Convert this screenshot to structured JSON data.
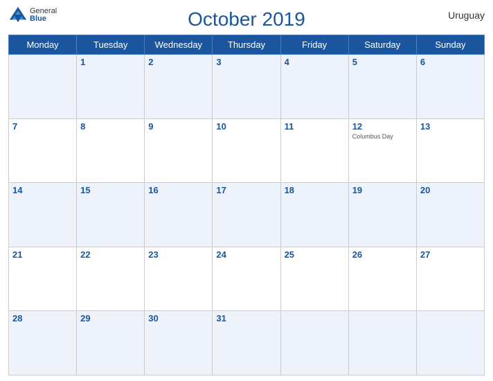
{
  "header": {
    "title": "October 2019",
    "country": "Uruguay",
    "logo": {
      "line1": "General",
      "line2": "Blue"
    }
  },
  "weekdays": [
    "Monday",
    "Tuesday",
    "Wednesday",
    "Thursday",
    "Friday",
    "Saturday",
    "Sunday"
  ],
  "weeks": [
    [
      {
        "day": "",
        "holiday": ""
      },
      {
        "day": "1",
        "holiday": ""
      },
      {
        "day": "2",
        "holiday": ""
      },
      {
        "day": "3",
        "holiday": ""
      },
      {
        "day": "4",
        "holiday": ""
      },
      {
        "day": "5",
        "holiday": ""
      },
      {
        "day": "6",
        "holiday": ""
      }
    ],
    [
      {
        "day": "7",
        "holiday": ""
      },
      {
        "day": "8",
        "holiday": ""
      },
      {
        "day": "9",
        "holiday": ""
      },
      {
        "day": "10",
        "holiday": ""
      },
      {
        "day": "11",
        "holiday": ""
      },
      {
        "day": "12",
        "holiday": "Columbus Day"
      },
      {
        "day": "13",
        "holiday": ""
      }
    ],
    [
      {
        "day": "14",
        "holiday": ""
      },
      {
        "day": "15",
        "holiday": ""
      },
      {
        "day": "16",
        "holiday": ""
      },
      {
        "day": "17",
        "holiday": ""
      },
      {
        "day": "18",
        "holiday": ""
      },
      {
        "day": "19",
        "holiday": ""
      },
      {
        "day": "20",
        "holiday": ""
      }
    ],
    [
      {
        "day": "21",
        "holiday": ""
      },
      {
        "day": "22",
        "holiday": ""
      },
      {
        "day": "23",
        "holiday": ""
      },
      {
        "day": "24",
        "holiday": ""
      },
      {
        "day": "25",
        "holiday": ""
      },
      {
        "day": "26",
        "holiday": ""
      },
      {
        "day": "27",
        "holiday": ""
      }
    ],
    [
      {
        "day": "28",
        "holiday": ""
      },
      {
        "day": "29",
        "holiday": ""
      },
      {
        "day": "30",
        "holiday": ""
      },
      {
        "day": "31",
        "holiday": ""
      },
      {
        "day": "",
        "holiday": ""
      },
      {
        "day": "",
        "holiday": ""
      },
      {
        "day": "",
        "holiday": ""
      }
    ]
  ]
}
